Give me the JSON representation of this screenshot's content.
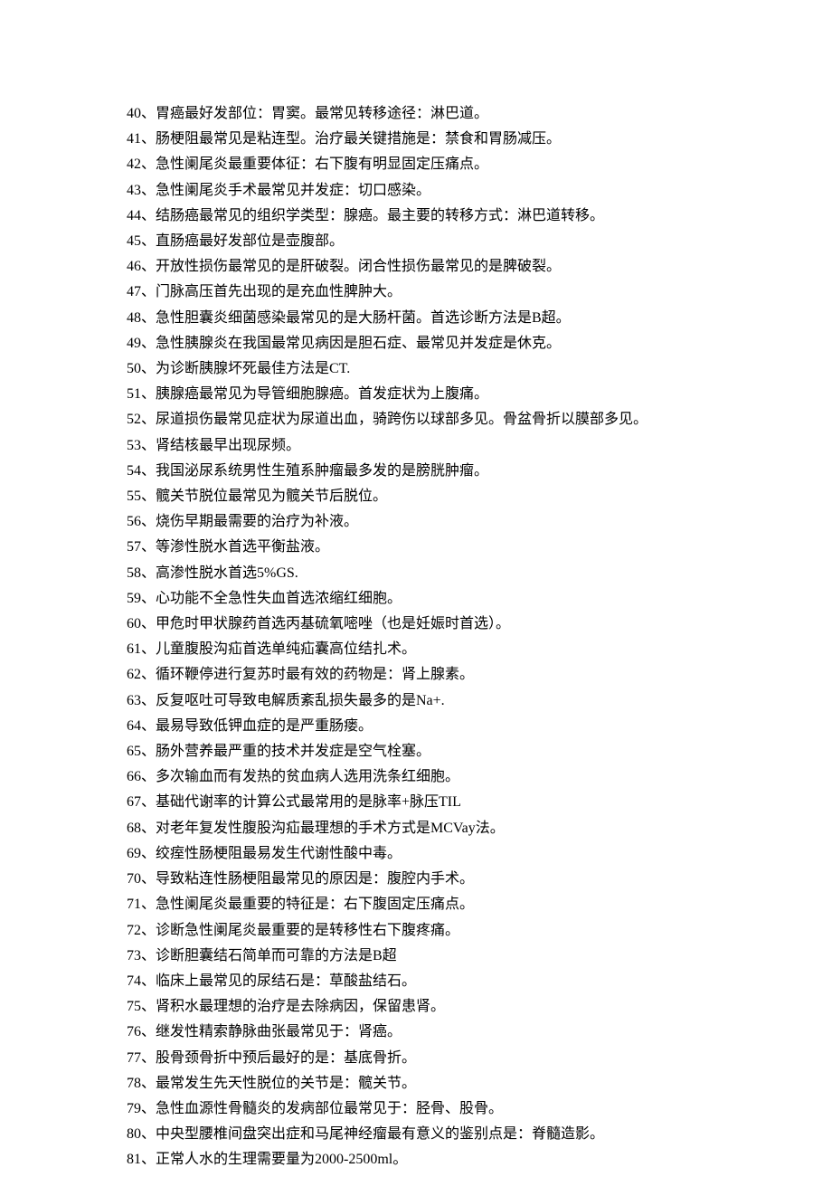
{
  "items": [
    "40、胃癌最好发部位：胃窦。最常见转移途径：淋巴道。",
    "41、肠梗阻最常见是粘连型。治疗最关键措施是：禁食和胃肠减压。",
    "42、急性阑尾炎最重要体征：右下腹有明显固定压痛点。",
    "43、急性阑尾炎手术最常见并发症：切口感染。",
    "44、结肠癌最常见的组织学类型：腺癌。最主要的转移方式：淋巴道转移。",
    "45、直肠癌最好发部位是壶腹部。",
    "46、开放性损伤最常见的是肝破裂。闭合性损伤最常见的是脾破裂。",
    "47、门脉高压首先出现的是充血性脾肿大。",
    "48、急性胆囊炎细菌感染最常见的是大肠杆菌。首选诊断方法是B超。",
    "49、急性胰腺炎在我国最常见病因是胆石症、最常见并发症是休克。",
    "50、为诊断胰腺坏死最佳方法是CT.",
    "51、胰腺癌最常见为导管细胞腺癌。首发症状为上腹痛。",
    "52、尿道损伤最常见症状为尿道出血，骑跨伤以球部多见。骨盆骨折以膜部多见。",
    "53、肾结核最早出现尿频。",
    "54、我国泌尿系统男性生殖系肿瘤最多发的是膀胱肿瘤。",
    "55、髋关节脱位最常见为髋关节后脱位。",
    "56、烧伤早期最需要的治疗为补液。",
    "57、等渗性脱水首选平衡盐液。",
    "58、高渗性脱水首选5%GS.",
    "59、心功能不全急性失血首选浓缩红细胞。",
    "60、甲危时甲状腺药首选丙基硫氧嘧唑（也是妊娠时首选）。",
    "61、儿童腹股沟疝首选单纯疝囊高位结扎术。",
    "62、循环鞭停进行复苏时最有效的药物是：肾上腺素。",
    "63、反复呕吐可导致电解质紊乱损失最多的是Na+.",
    "64、最易导致低钾血症的是严重肠瘘。",
    "65、肠外营养最严重的技术并发症是空气栓塞。",
    "66、多次输血而有发热的贫血病人选用洗条红细胞。",
    "67、基础代谢率的计算公式最常用的是脉率+脉压TIL",
    "68、对老年复发性腹股沟疝最理想的手术方式是MCVay法。",
    "69、绞痓性肠梗阻最易发生代谢性酸中毒。",
    "70、导致粘连性肠梗阻最常见的原因是：腹腔内手术。",
    "71、急性阑尾炎最重要的特征是：右下腹固定压痛点。",
    "72、诊断急性阑尾炎最重要的是转移性右下腹疼痛。",
    "73、诊断胆囊结石简单而可靠的方法是B超",
    "74、临床上最常见的尿结石是：草酸盐结石。",
    "75、肾积水最理想的治疗是去除病因，保留患肾。",
    "76、继发性精索静脉曲张最常见于：肾癌。",
    "77、股骨颈骨折中预后最好的是：基底骨折。",
    "78、最常发生先天性脱位的关节是：髋关节。",
    "79、急性血源性骨髓炎的发病部位最常见于：胫骨、股骨。",
    "80、中央型腰椎间盘突出症和马尾神经瘤最有意义的鉴别点是：脊髓造影。",
    "81、正常人水的生理需要量为2000-2500ml。"
  ]
}
